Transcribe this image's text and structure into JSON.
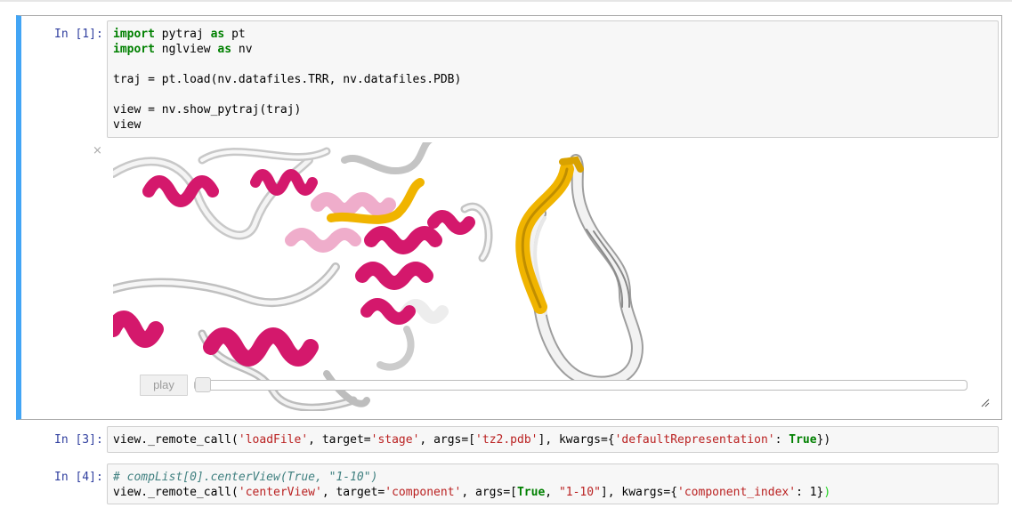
{
  "cells": [
    {
      "prompt": "In [1]:",
      "lines": [
        [
          {
            "t": "import",
            "c": "kw"
          },
          {
            "t": " pytraj "
          },
          {
            "t": "as",
            "c": "kw"
          },
          {
            "t": " pt"
          }
        ],
        [
          {
            "t": "import",
            "c": "kw"
          },
          {
            "t": " nglview "
          },
          {
            "t": "as",
            "c": "kw"
          },
          {
            "t": " nv"
          }
        ],
        [],
        [
          {
            "t": "traj = pt.load(nv.datafiles.TRR, nv.datafiles.PDB)"
          }
        ],
        [],
        [
          {
            "t": "view = nv.show_pytraj(traj)"
          }
        ],
        [
          {
            "t": "view"
          }
        ]
      ]
    },
    {
      "prompt": "In [3]:",
      "lines": [
        [
          {
            "t": "view._remote_call("
          },
          {
            "t": "'loadFile'",
            "c": "str"
          },
          {
            "t": ", target="
          },
          {
            "t": "'stage'",
            "c": "str"
          },
          {
            "t": ", args=["
          },
          {
            "t": "'tz2.pdb'",
            "c": "str"
          },
          {
            "t": "], kwargs={"
          },
          {
            "t": "'defaultRepresentation'",
            "c": "str"
          },
          {
            "t": ": "
          },
          {
            "t": "True",
            "c": "bi"
          },
          {
            "t": "})"
          }
        ]
      ]
    },
    {
      "prompt": "In [4]:",
      "lines": [
        [
          {
            "t": "# compList[0].centerView(True, \"1-10\")",
            "c": "cm"
          }
        ],
        [
          {
            "t": "view._remote_call("
          },
          {
            "t": "'centerView'",
            "c": "str"
          },
          {
            "t": ", target="
          },
          {
            "t": "'component'",
            "c": "str"
          },
          {
            "t": ", args=["
          },
          {
            "t": "True",
            "c": "bi"
          },
          {
            "t": ", "
          },
          {
            "t": "\"1-10\"",
            "c": "str"
          },
          {
            "t": "], kwargs={"
          },
          {
            "t": "'component_index'",
            "c": "str"
          },
          {
            "t": ": 1}"
          },
          {
            "t": ")",
            "c": "paren"
          }
        ]
      ]
    }
  ],
  "widget": {
    "close_glyph": "×",
    "play_label": "play",
    "slider_value": 0,
    "colors": {
      "helix": "#d4186c",
      "strand": "#f0b400",
      "coil": "#d6d6d6",
      "selected_border": "#42a5f5",
      "prompt": "#303f9f"
    }
  }
}
